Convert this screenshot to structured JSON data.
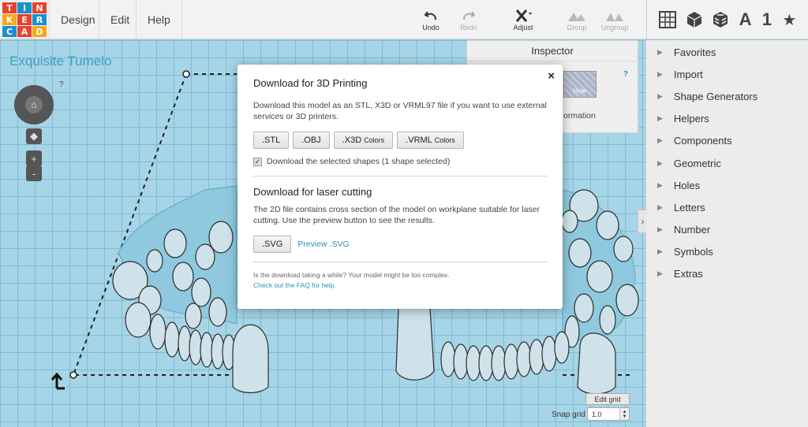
{
  "logo": {
    "letters": [
      "T",
      "I",
      "N",
      "K",
      "E",
      "R",
      "C",
      "A",
      "D"
    ],
    "colors": [
      "#e8412c",
      "#1b8fcf",
      "#e8412c",
      "#f7a81b",
      "#e8412c",
      "#1b8fcf",
      "#1b8fcf",
      "#e8412c",
      "#f7a81b"
    ]
  },
  "menu": {
    "design": "Design",
    "edit": "Edit",
    "help": "Help"
  },
  "toolbar": {
    "undo": "Undo",
    "redo": "Redo",
    "adjust": "Adjust",
    "group": "Group",
    "ungroup": "Ungroup"
  },
  "view": {
    "letter_a": "A",
    "number_1": "1"
  },
  "design_name": "Exquisite Tumelo",
  "nav": {
    "help": "?",
    "zoom_in": "+",
    "zoom_out": "-"
  },
  "inspector": {
    "title": "Inspector",
    "help": "?",
    "hole_label": "Hole",
    "partial_text": "ormation"
  },
  "sidebar": {
    "items": [
      {
        "label": "Favorites"
      },
      {
        "label": "Import"
      },
      {
        "label": "Shape Generators"
      },
      {
        "label": "Helpers"
      },
      {
        "label": "Components"
      },
      {
        "label": "Geometric"
      },
      {
        "label": "Holes"
      },
      {
        "label": "Letters"
      },
      {
        "label": "Number"
      },
      {
        "label": "Symbols"
      },
      {
        "label": "Extras"
      }
    ]
  },
  "grid": {
    "edit_grid": "Edit grid",
    "snap_label": "Snap grid",
    "snap_value": "1.0"
  },
  "modal": {
    "close": "×",
    "title": "Download for 3D Printing",
    "description": "Download this model as an STL, X3D or VRML97 file if you want to use external services or 3D printers.",
    "buttons": [
      {
        "label": ".STL",
        "sub": ""
      },
      {
        "label": ".OBJ",
        "sub": ""
      },
      {
        "label": ".X3D",
        "sub": "Colors"
      },
      {
        "label": ".VRML",
        "sub": "Colors"
      }
    ],
    "checkbox_label": "Download the selected shapes (1 shape selected)",
    "laser_title": "Download for laser cutting",
    "laser_description": "The 2D file contains cross section of the model on workplane suitable for laser cutting. Use the preview button to see the results.",
    "svg_button": ".SVG",
    "preview_link": "Preview .SVG",
    "note": "Is the download taking a while? Your model might be too complex.",
    "faq_link": "Check out the FAQ for help."
  }
}
